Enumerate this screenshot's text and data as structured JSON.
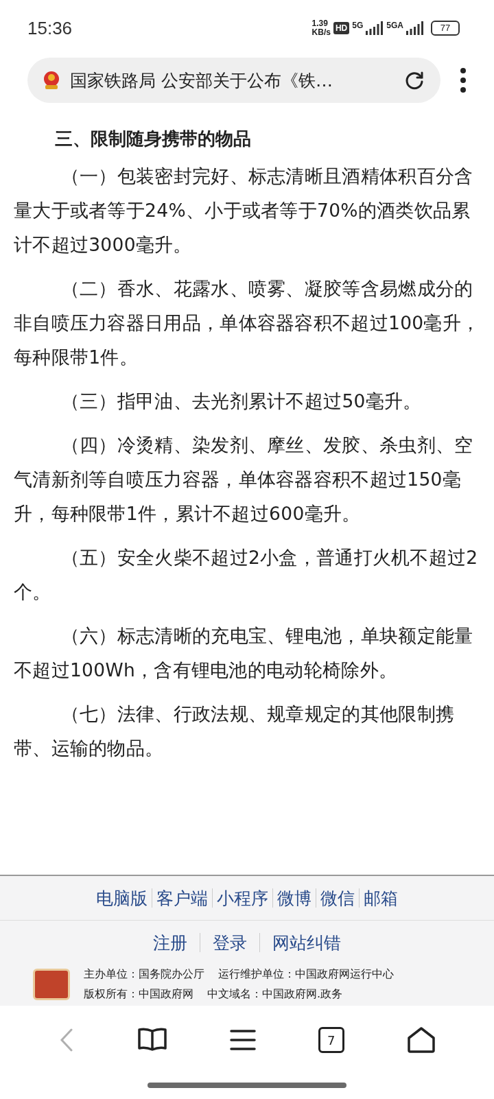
{
  "status_bar": {
    "time": "15:36",
    "net_speed": "1.39",
    "net_unit": "KB/s",
    "hd": "HD",
    "sim1": "5G",
    "sim2": "5GA",
    "battery": "77"
  },
  "address_bar": {
    "title": "国家铁路局 公安部关于公布《铁…"
  },
  "article": {
    "heading": "三、限制随身携带的物品",
    "paragraphs": [
      "（一）包装密封完好、标志清晰且酒精体积百分含量大于或者等于24%、小于或者等于70%的酒类饮品累计不超过3000毫升。",
      "（二）香水、花露水、喷雾、凝胶等含易燃成分的非自喷压力容器日用品，单体容器容积不超过100毫升，每种限带1件。",
      "（三）指甲油、去光剂累计不超过50毫升。",
      "（四）冷烫精、染发剂、摩丝、发胶、杀虫剂、空气清新剂等自喷压力容器，单体容器容积不超过150毫升，每种限带1件，累计不超过600毫升。",
      "（五）安全火柴不超过2小盒，普通打火机不超过2个。",
      "（六）标志清晰的充电宝、锂电池，单块额定能量不超过100Wh，含有锂电池的电动轮椅除外。",
      "（七）法律、行政法规、规章规定的其他限制携带、运输的物品。"
    ]
  },
  "footer": {
    "links": [
      "电脑版",
      "客户端",
      "小程序",
      "微博",
      "微信",
      "邮箱"
    ],
    "account_links": [
      "注册",
      "登录",
      "网站纠错"
    ],
    "info": [
      [
        "主办单位：国务院办公厅",
        "运行维护单位：中国政府网运行中心"
      ],
      [
        "版权所有：中国政府网",
        "中文域名：中国政府网.政务"
      ]
    ]
  },
  "toolbar": {
    "back_disabled": true,
    "tab_count": "7"
  }
}
